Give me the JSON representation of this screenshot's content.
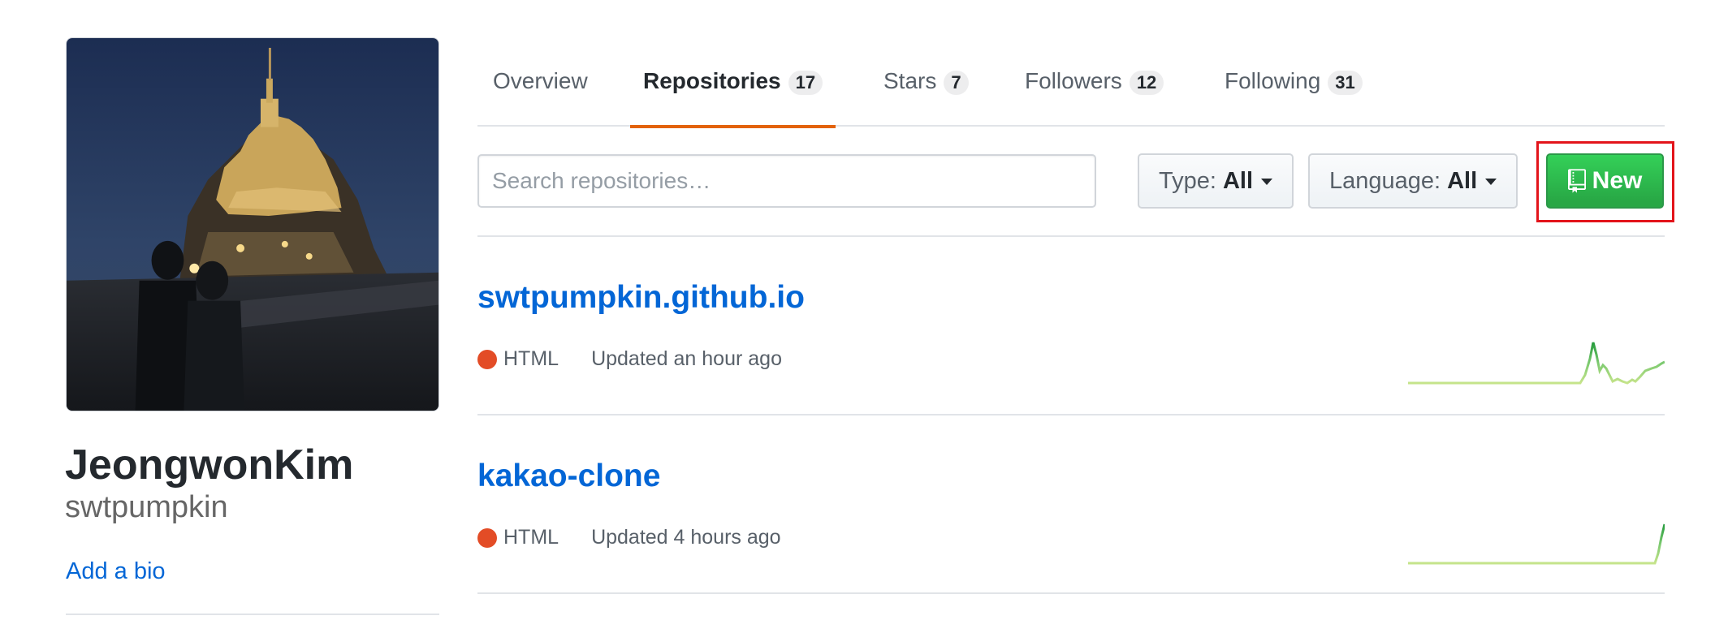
{
  "profile": {
    "name": "JeongwonKim",
    "username": "swtpumpkin",
    "add_bio": "Add a bio"
  },
  "tabs": [
    {
      "label": "Overview",
      "count": null,
      "selected": false
    },
    {
      "label": "Repositories",
      "count": "17",
      "selected": true
    },
    {
      "label": "Stars",
      "count": "7",
      "selected": false
    },
    {
      "label": "Followers",
      "count": "12",
      "selected": false
    },
    {
      "label": "Following",
      "count": "31",
      "selected": false
    }
  ],
  "filters": {
    "search_placeholder": "Search repositories…",
    "type_label": "Type:",
    "type_value": "All",
    "language_label": "Language:",
    "language_value": "All",
    "new_label": "New"
  },
  "repos": [
    {
      "name": "swtpumpkin.github.io",
      "language": "HTML",
      "language_color": "#e34c26",
      "updated": "Updated an hour ago"
    },
    {
      "name": "kakao-clone",
      "language": "HTML",
      "language_color": "#e34c26",
      "updated": "Updated 4 hours ago"
    }
  ],
  "colors": {
    "accent_tab_underline": "#e36209",
    "link": "#0366d6",
    "new_button": "#28a745",
    "highlight": "#e3141b",
    "sparkline": "#c6e48b"
  }
}
